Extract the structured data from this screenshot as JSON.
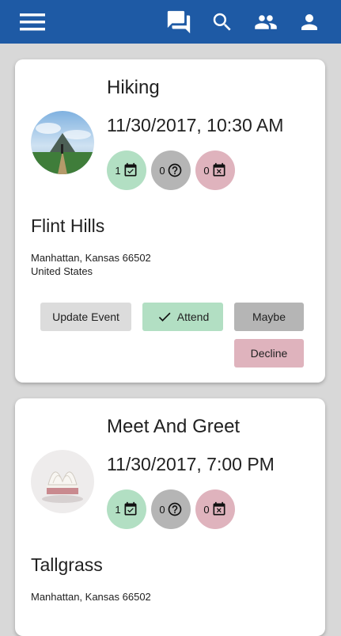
{
  "app_bar": {
    "icons": [
      "menu-icon",
      "forum-icon",
      "search-icon",
      "people-icon",
      "person-icon"
    ],
    "color": "#1e5aa5"
  },
  "events": [
    {
      "title": "Hiking",
      "datetime": "11/30/2017, 10:30 AM",
      "rsvp": {
        "going": "1",
        "maybe": "0",
        "declined": "0"
      },
      "venue": "Flint Hills",
      "address_line1": "Manhattan, Kansas 66502",
      "address_line2": "United States",
      "actions": {
        "update": "Update Event",
        "attend": "Attend",
        "maybe": "Maybe",
        "decline": "Decline"
      }
    },
    {
      "title": "Meet And Greet",
      "datetime": "11/30/2017, 7:00 PM",
      "rsvp": {
        "going": "1",
        "maybe": "0",
        "declined": "0"
      },
      "venue": "Tallgrass",
      "address_line1": "Manhattan, Kansas 66502"
    }
  ],
  "colors": {
    "going": "#b2dfc3",
    "maybe": "#b5b5b5",
    "declined": "#dfb3bd",
    "update": "#dcdcdc"
  }
}
